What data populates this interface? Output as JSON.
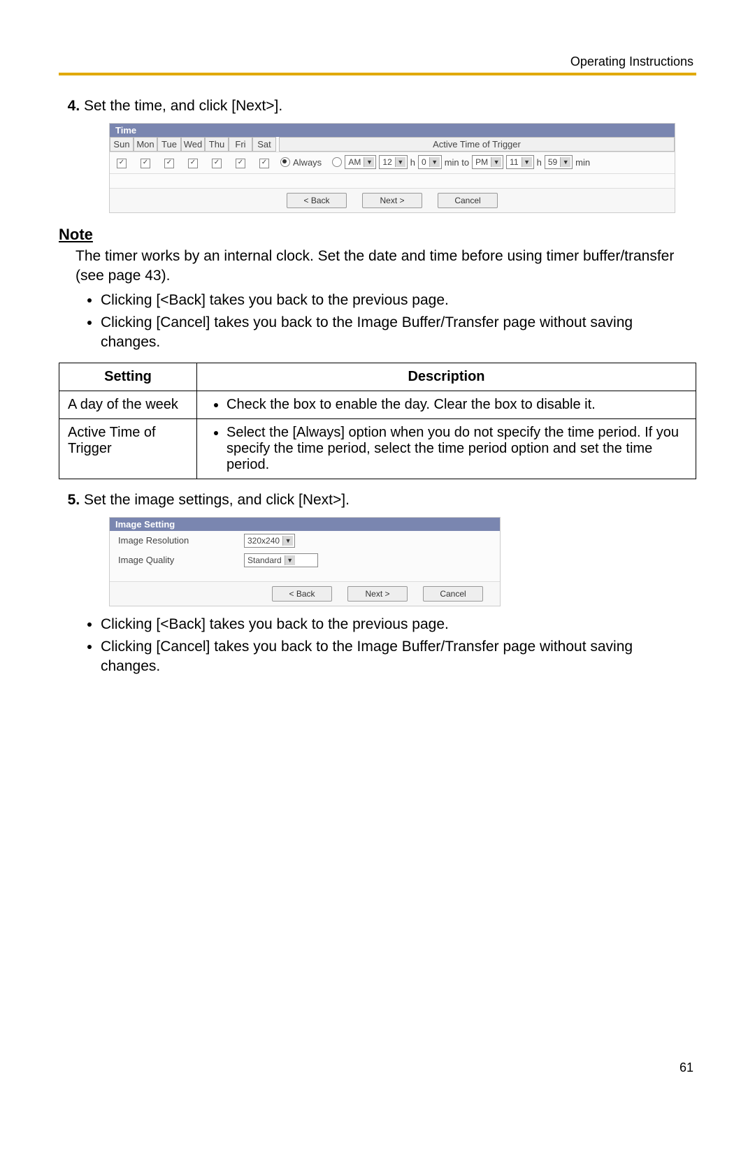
{
  "header": {
    "title": "Operating Instructions"
  },
  "footer": {
    "page_number": "61"
  },
  "steps": [
    {
      "text": "Set the time, and click [Next>]."
    },
    {
      "text": "Set the image settings, and click [Next>]."
    }
  ],
  "time_panel": {
    "title": "Time",
    "days": [
      "Sun",
      "Mon",
      "Tue",
      "Wed",
      "Thu",
      "Fri",
      "Sat"
    ],
    "trigger_header": "Active Time of Trigger",
    "always_label": "Always",
    "start": {
      "ampm": "AM",
      "hour": "12",
      "min": "0"
    },
    "end": {
      "ampm": "PM",
      "hour": "11",
      "min": "59"
    },
    "labels": {
      "h": "h",
      "min_to": "min to",
      "min": "min"
    },
    "buttons": {
      "back": "< Back",
      "next": "Next >",
      "cancel": "Cancel"
    }
  },
  "note": {
    "heading": "Note",
    "body": "The timer works by an internal clock. Set the date and time before using timer buffer/transfer (see page 43).",
    "bullets": [
      "Clicking [<Back] takes you back to the previous page.",
      "Clicking [Cancel] takes you back to the Image Buffer/Transfer page without saving changes."
    ]
  },
  "table": {
    "headers": [
      "Setting",
      "Description"
    ],
    "rows": [
      {
        "setting": "A day of the week",
        "desc": "Check the box to enable the day. Clear the box to disable it."
      },
      {
        "setting": "Active Time of Trigger",
        "desc": "Select the [Always] option when you do not specify the time period. If you specify the time period, select the time period option and set the time period."
      }
    ]
  },
  "image_panel": {
    "title": "Image Setting",
    "rows": [
      {
        "label": "Image Resolution",
        "value": "320x240"
      },
      {
        "label": "Image Quality",
        "value": "Standard"
      }
    ],
    "buttons": {
      "back": "< Back",
      "next": "Next >",
      "cancel": "Cancel"
    }
  },
  "step5_bullets": [
    "Clicking [<Back] takes you back to the previous page.",
    "Clicking [Cancel] takes you back to the Image Buffer/Transfer page without saving changes."
  ]
}
